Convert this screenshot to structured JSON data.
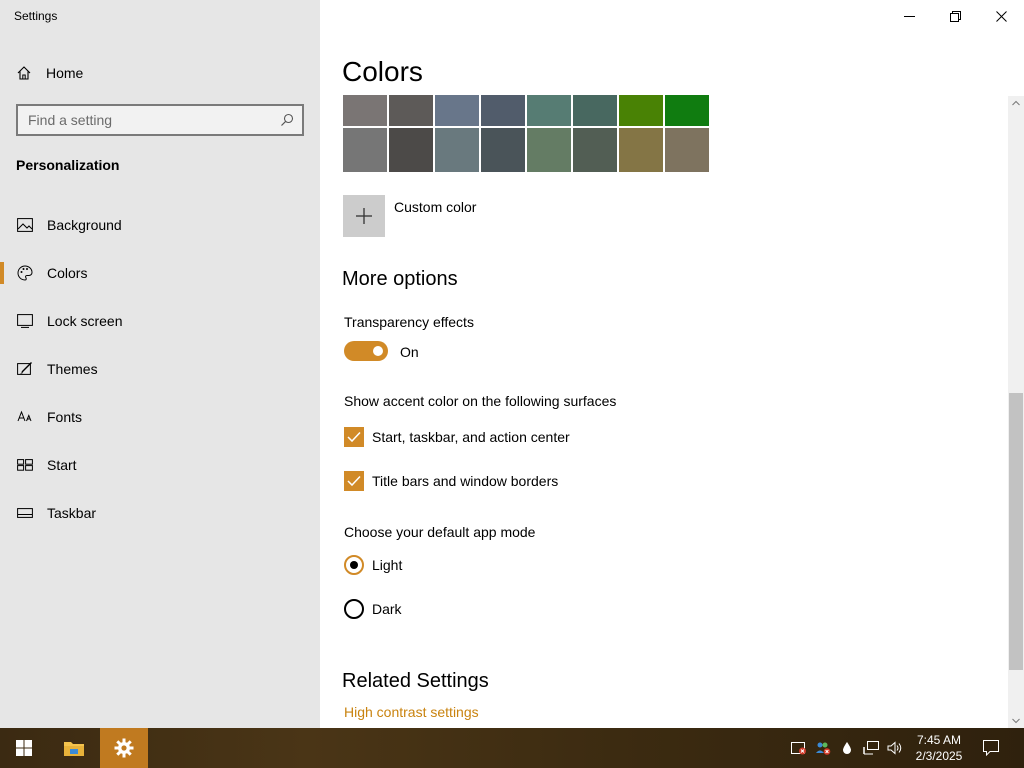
{
  "app": {
    "title": "Settings"
  },
  "sidebar": {
    "home_label": "Home",
    "search_placeholder": "Find a setting",
    "section_title": "Personalization",
    "items": [
      {
        "label": "Background",
        "icon": "picture-icon"
      },
      {
        "label": "Colors",
        "icon": "palette-icon",
        "active": true
      },
      {
        "label": "Lock screen",
        "icon": "lock-screen-icon"
      },
      {
        "label": "Themes",
        "icon": "brush-icon"
      },
      {
        "label": "Fonts",
        "icon": "font-icon"
      },
      {
        "label": "Start",
        "icon": "start-icon"
      },
      {
        "label": "Taskbar",
        "icon": "taskbar-icon"
      }
    ]
  },
  "main": {
    "title": "Colors",
    "swatches_row1": [
      "#7a7574",
      "#5d5a58",
      "#68768a",
      "#515c6b",
      "#567c73",
      "#486860",
      "#498205",
      "#107c10"
    ],
    "swatches_row2": [
      "#767676",
      "#4c4a48",
      "#69797e",
      "#4a5459",
      "#647c64",
      "#525e54",
      "#847545",
      "#7e735f"
    ],
    "custom_color_label": "Custom color",
    "more_options_title": "More options",
    "transparency_label": "Transparency effects",
    "transparency_state": "On",
    "accent_surfaces_label": "Show accent color on the following surfaces",
    "checkboxes": [
      {
        "label": "Start, taskbar, and action center",
        "checked": true
      },
      {
        "label": "Title bars and window borders",
        "checked": true
      }
    ],
    "app_mode_label": "Choose your default app mode",
    "app_modes": [
      {
        "label": "Light",
        "selected": true
      },
      {
        "label": "Dark",
        "selected": false
      }
    ],
    "related_title": "Related Settings",
    "related_link": "High contrast settings"
  },
  "taskbar": {
    "time": "7:45 AM",
    "date": "2/3/2025"
  },
  "colors": {
    "accent": "#d18a27",
    "link": "#c9830f",
    "sidebar_bg": "#e6e6e6"
  }
}
